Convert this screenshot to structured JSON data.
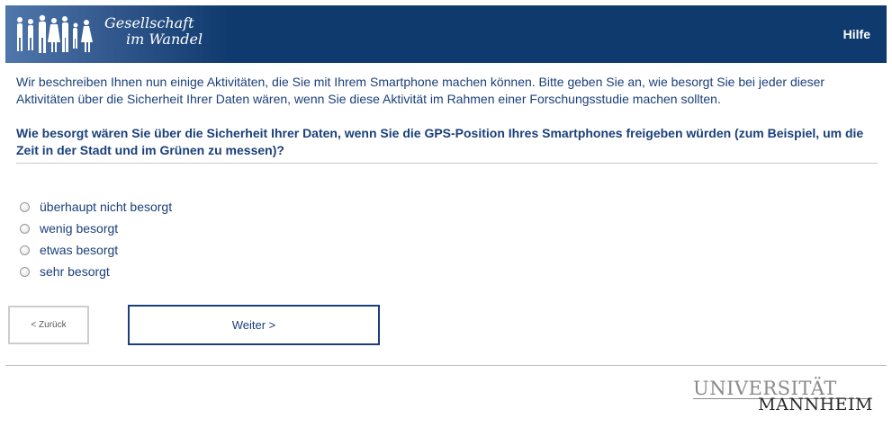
{
  "header": {
    "brand_line1": "Gesellschaft",
    "brand_line2": "im Wandel",
    "help_label": "Hilfe",
    "bg_color": "#0f3a6e"
  },
  "intro": "Wir beschreiben Ihnen nun einige Aktivitäten, die Sie mit Ihrem Smartphone machen können. Bitte geben Sie an, wie besorgt Sie bei jeder dieser Aktivitäten über die Sicherheit Ihrer Daten wären, wenn Sie diese Aktivität im Rahmen einer Forschungsstudie machen sollten.",
  "question": "Wie besorgt wären Sie über die Sicherheit Ihrer Daten, wenn Sie die GPS-Position Ihres Smartphones freigeben würden (zum Beispiel, um die Zeit in der Stadt und im Grünen zu messen)?",
  "options": [
    {
      "label": "überhaupt nicht besorgt"
    },
    {
      "label": "wenig besorgt"
    },
    {
      "label": "etwas besorgt"
    },
    {
      "label": "sehr besorgt"
    }
  ],
  "nav": {
    "back_label": "< Zurück",
    "next_label": "Weiter >"
  },
  "footer": {
    "logo_top": "UNIVERSITÄT",
    "logo_bottom": "MANNHEIM"
  },
  "colors": {
    "text": "#1a3f7a",
    "header": "#0f3a6e"
  }
}
